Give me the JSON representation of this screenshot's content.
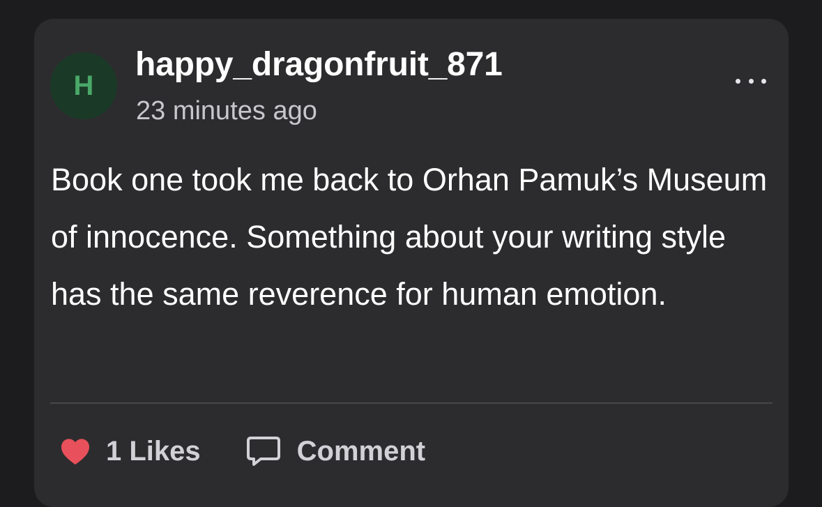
{
  "post": {
    "avatar_initial": "H",
    "username": "happy_dragonfruit_871",
    "time_ago": "23 minutes ago",
    "body": "Book one took me back to Orhan Pamuk’s Museum of innocence. Something about your writing style has the same reverence for human emotion.",
    "more_icon": "ellipsis-icon"
  },
  "actions": {
    "likes_label": "1 Likes",
    "comment_label": "Comment",
    "like_icon": "heart-icon",
    "comment_icon": "comment-bubble-icon"
  },
  "colors": {
    "background": "#1c1c1e",
    "card": "#2c2c2e",
    "avatar_bg": "#1a3a27",
    "avatar_text": "#4aa868",
    "heart": "#e8505b"
  }
}
